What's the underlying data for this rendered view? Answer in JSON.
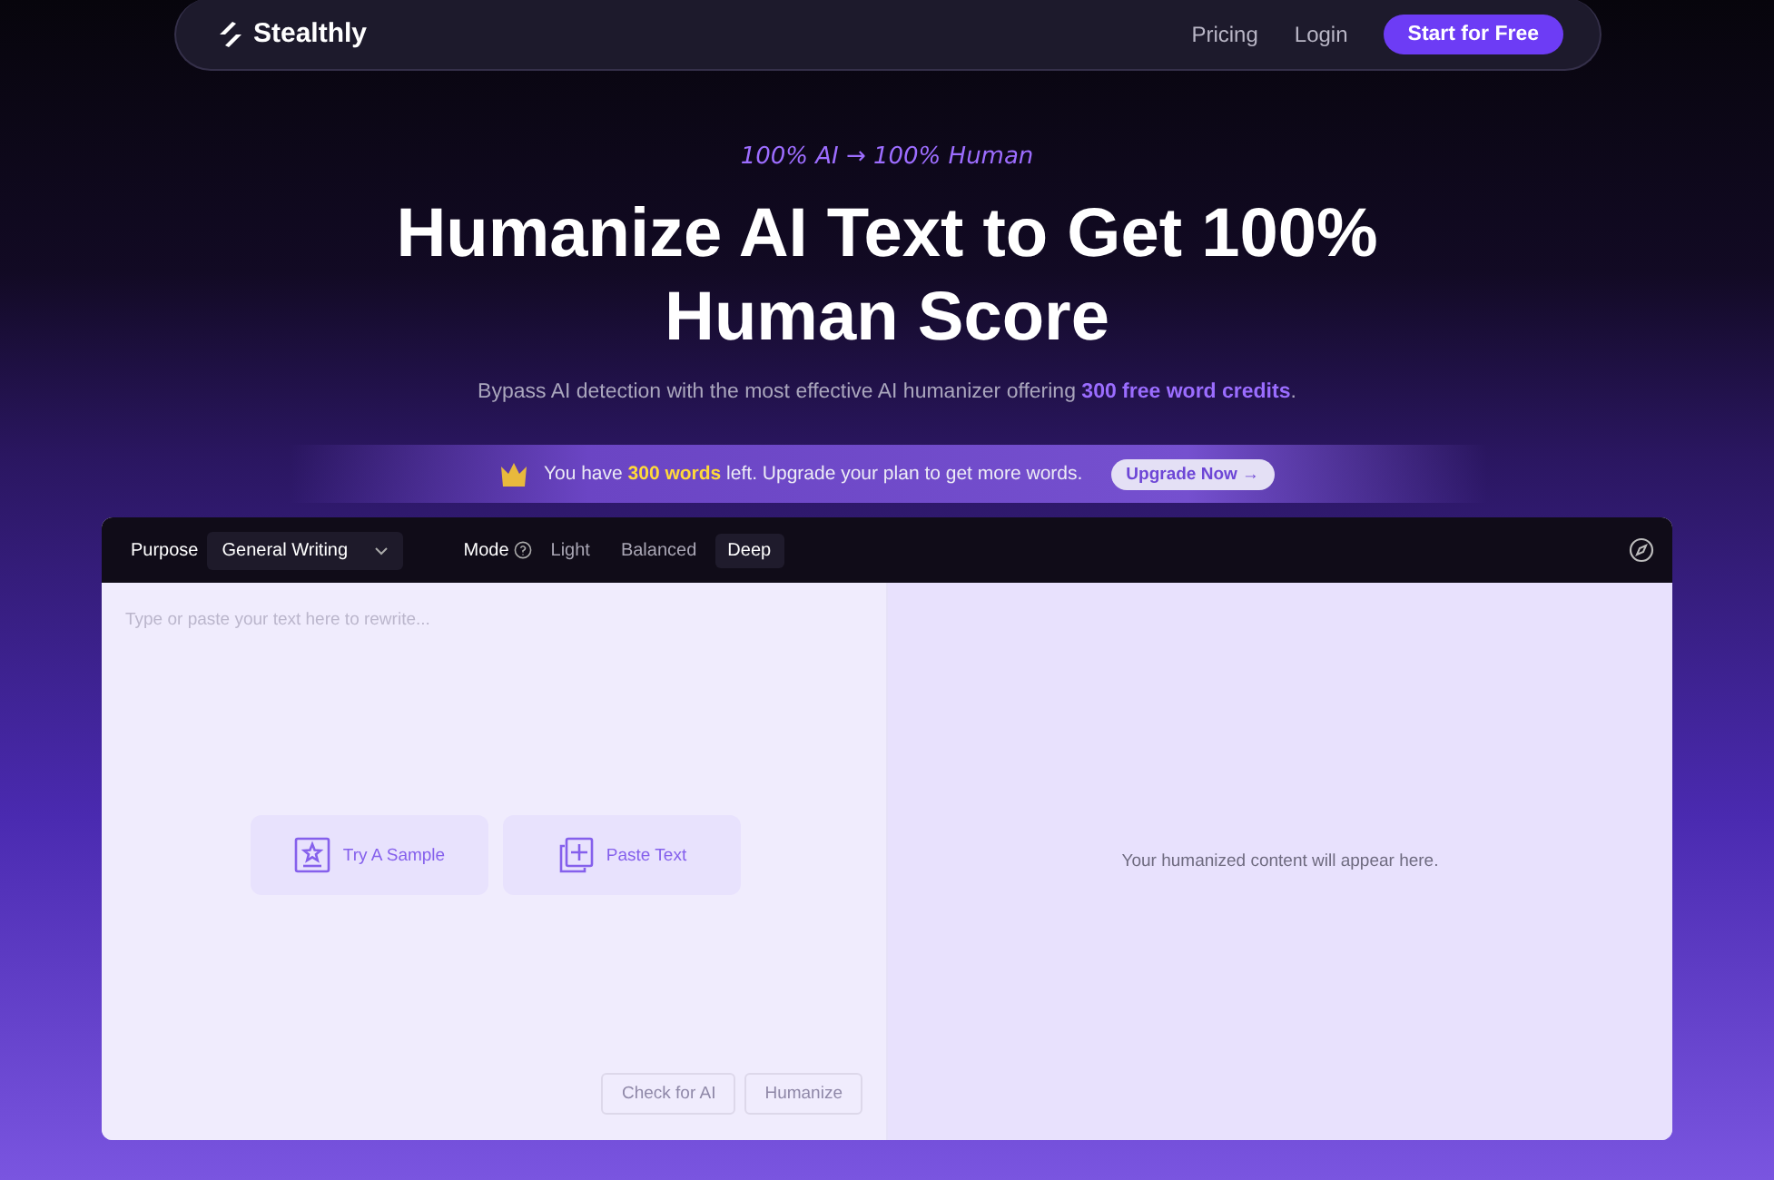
{
  "nav": {
    "brand": "Stealthly",
    "links": [
      "Pricing",
      "Login"
    ],
    "cta": "Start for Free"
  },
  "hero": {
    "tagline": "100% AI → 100% Human",
    "title": "Humanize AI Text to Get 100% Human Score",
    "subtitle": "Bypass AI detection with the most effective AI humanizer offering **300 free word credits**."
  },
  "banner": {
    "text": "You have **300 words** left. Upgrade your plan to get more words.",
    "button": "Upgrade Now",
    "arrow": "→"
  },
  "editor": {
    "purpose_label": "Purpose",
    "purpose_value": "General Writing",
    "mode_label": "Mode",
    "modes": [
      {
        "label": "Light",
        "selected": false
      },
      {
        "label": "Balanced",
        "selected": false
      },
      {
        "label": "Deep",
        "selected": true
      }
    ],
    "input_placeholder": "Type or paste your text here to rewrite...",
    "actions": [
      {
        "kind": "sample",
        "label": "Try A Sample"
      },
      {
        "kind": "paste",
        "label": "Paste Text"
      }
    ],
    "buttons": [
      {
        "label": "Check for AI",
        "disabled": true
      },
      {
        "label": "Humanize",
        "disabled": true
      }
    ],
    "output_placeholder": "Your humanized content will appear here."
  }
}
